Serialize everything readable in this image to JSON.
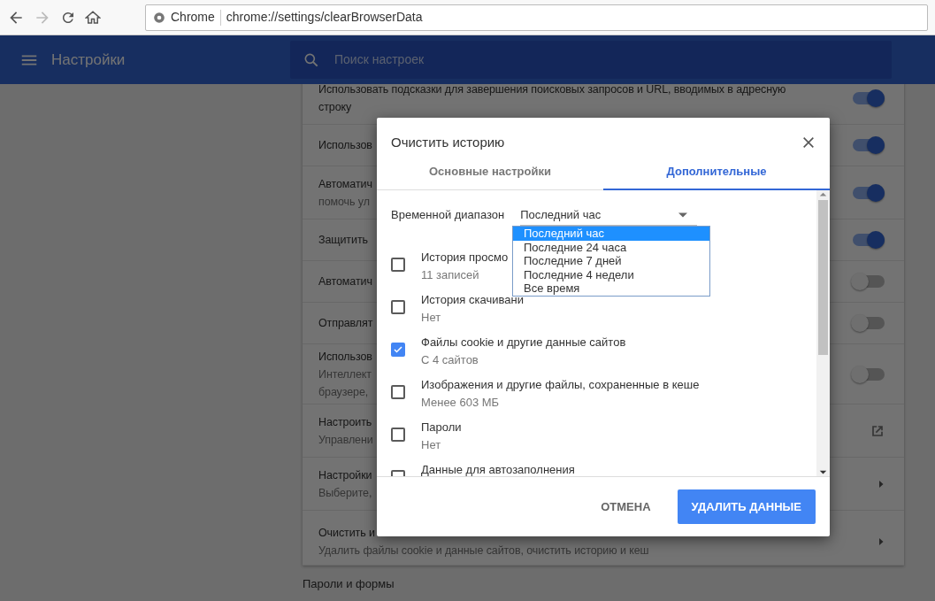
{
  "browser": {
    "site_chip": "Chrome",
    "url": "chrome://settings/clearBrowserData"
  },
  "header": {
    "title": "Настройки",
    "search_placeholder": "Поиск настроек"
  },
  "settings_rows": [
    {
      "kind": "toggle",
      "on": true,
      "lines": [
        "Использовать подсказки для завершения поисковых запросов и URL, вводимых в адресную",
        "строку"
      ]
    },
    {
      "kind": "toggle",
      "on": true,
      "lines": [
        "Использов"
      ]
    },
    {
      "kind": "toggle",
      "on": true,
      "lines": [
        "Автоматич",
        "помочь ул"
      ]
    },
    {
      "kind": "toggle",
      "on": true,
      "lines": [
        "Защитить"
      ]
    },
    {
      "kind": "toggle",
      "on": false,
      "lines": [
        "Автоматич"
      ]
    },
    {
      "kind": "toggle",
      "on": false,
      "lines": [
        "Отправлят"
      ]
    },
    {
      "kind": "toggle",
      "on": false,
      "lines": [
        "Использов",
        "Интеллект",
        "браузере,"
      ]
    },
    {
      "kind": "external",
      "lines": [
        "Настроить",
        "Управлени"
      ]
    },
    {
      "kind": "arrow",
      "lines": [
        "Настройки",
        "Выберите,"
      ]
    },
    {
      "kind": "arrow",
      "lines": [
        "Очистить и",
        "Удалить файлы cookie и данные сайтов, очистить историю и кеш"
      ]
    }
  ],
  "section_heading": "Пароли и формы",
  "dialog": {
    "title": "Очистить историю",
    "tabs": [
      {
        "label": "Основные настройки",
        "selected": false
      },
      {
        "label": "Дополнительные",
        "selected": true
      }
    ],
    "time_range": {
      "label": "Временной диапазон",
      "value": "Последний час",
      "options": [
        {
          "label": "Последний час",
          "selected": true
        },
        {
          "label": "Последние 24 часа",
          "selected": false
        },
        {
          "label": "Последние 7 дней",
          "selected": false
        },
        {
          "label": "Последние 4 недели",
          "selected": false
        },
        {
          "label": "Все время",
          "selected": false
        }
      ]
    },
    "items": [
      {
        "label": "История просмо",
        "detail": "11 записей",
        "checked": false
      },
      {
        "label": "История скачивани",
        "detail": "Нет",
        "checked": false
      },
      {
        "label": "Файлы cookie и другие данные сайтов",
        "detail": "С 4 сайтов",
        "checked": true
      },
      {
        "label": "Изображения и другие файлы, сохраненные в кеше",
        "detail": "Менее 603 МБ",
        "checked": false
      },
      {
        "label": "Пароли",
        "detail": "Нет",
        "checked": false
      },
      {
        "label": "Данные для автозаполнения",
        "checked": false
      }
    ],
    "cancel": "ОТМЕНА",
    "confirm": "УДАЛИТЬ ДАННЫЕ"
  }
}
